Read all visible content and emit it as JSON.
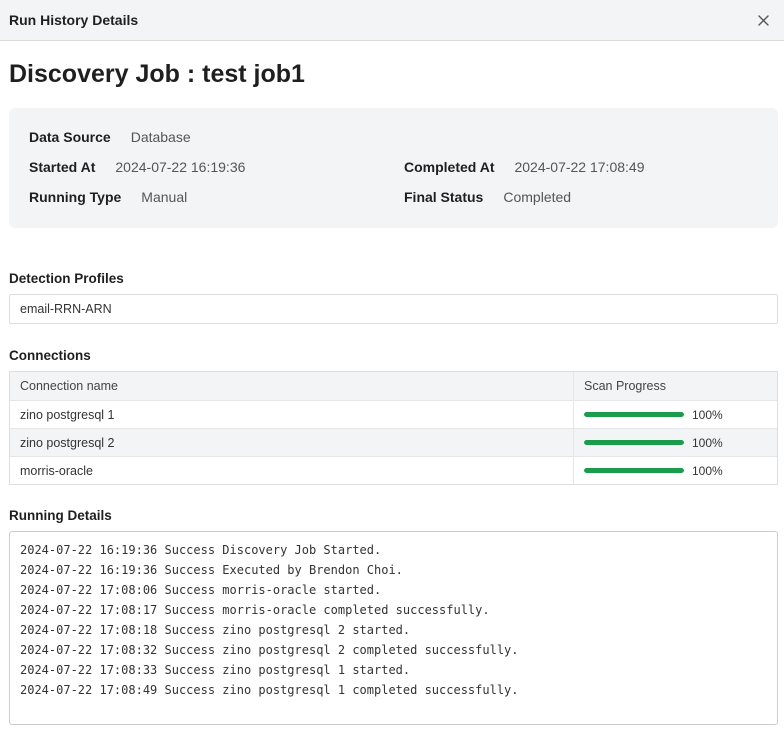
{
  "header": {
    "title": "Run History Details"
  },
  "job": {
    "title": "Discovery Job : test job1"
  },
  "info": {
    "data_source": {
      "label": "Data Source",
      "value": "Database"
    },
    "started_at": {
      "label": "Started At",
      "value": "2024-07-22 16:19:36"
    },
    "completed_at": {
      "label": "Completed At",
      "value": "2024-07-22 17:08:49"
    },
    "running_type": {
      "label": "Running Type",
      "value": "Manual"
    },
    "final_status": {
      "label": "Final Status",
      "value": "Completed"
    }
  },
  "profiles": {
    "label": "Detection Profiles",
    "value": "email-RRN-ARN"
  },
  "connections": {
    "label": "Connections",
    "columns": [
      "Connection name",
      "Scan Progress"
    ],
    "rows": [
      {
        "name": "zino postgresql 1",
        "progress": 1.0,
        "progress_label": "100%"
      },
      {
        "name": "zino postgresql 2",
        "progress": 1.0,
        "progress_label": "100%"
      },
      {
        "name": "morris-oracle",
        "progress": 1.0,
        "progress_label": "100%"
      }
    ]
  },
  "details": {
    "label": "Running Details",
    "lines": [
      "2024-07-22 16:19:36 Success Discovery Job Started.",
      "2024-07-22 16:19:36 Success Executed by Brendon Choi.",
      "2024-07-22 17:08:06 Success morris-oracle started.",
      "2024-07-22 17:08:17 Success morris-oracle completed successfully.",
      "2024-07-22 17:08:18 Success zino postgresql 2 started.",
      "2024-07-22 17:08:32 Success zino postgresql 2 completed successfully.",
      "2024-07-22 17:08:33 Success zino postgresql 1 started.",
      "2024-07-22 17:08:49 Success zino postgresql 1 completed successfully."
    ]
  },
  "colors": {
    "progress": "#1a9c4a",
    "panel_bg": "#f3f4f5"
  },
  "icons": {
    "close": "close-icon"
  }
}
